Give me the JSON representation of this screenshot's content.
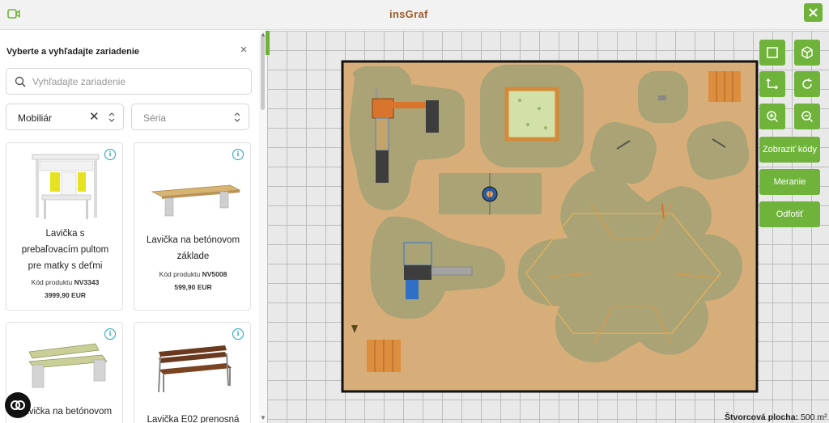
{
  "app": {
    "logo": "insGraf"
  },
  "panel": {
    "title": "Vyberte a vyhľadajte zariadenie",
    "search_placeholder": "Vyhľadajte zariadenie",
    "category": "Mobiliár",
    "series_placeholder": "Séria",
    "products": [
      {
        "name_lines": [
          "Lavička s",
          "prebaľovacím pultom",
          "pre matky s deťmi"
        ],
        "code_label": "Kód produktu",
        "code": "NV3343",
        "price": "3999,90 EUR"
      },
      {
        "name_lines": [
          "Lavička na betónovom",
          "základe"
        ],
        "code_label": "Kód produktu",
        "code": "NV5008",
        "price": "599,90 EUR"
      },
      {
        "name_lines": [
          "Lavička na betónovom"
        ]
      },
      {
        "name_lines": [
          "Lavička E02 prenosná"
        ]
      }
    ]
  },
  "tools": {
    "show_codes": "Zobraziť kódy",
    "measure": "Meranie",
    "remove": "Odfotiť",
    "icons": [
      "select-icon",
      "cube-3d-icon",
      "move-arrows-icon",
      "rotate-icon",
      "zoom-in-icon",
      "zoom-out-icon"
    ]
  },
  "footer": {
    "area_label": "Štvorcová plocha:",
    "area_value": "500 m²"
  },
  "colors": {
    "accent": "#6fb33a",
    "ground": "#d7ae7a",
    "safety_zone": "#a9a375",
    "info": "#1ea5c4"
  }
}
